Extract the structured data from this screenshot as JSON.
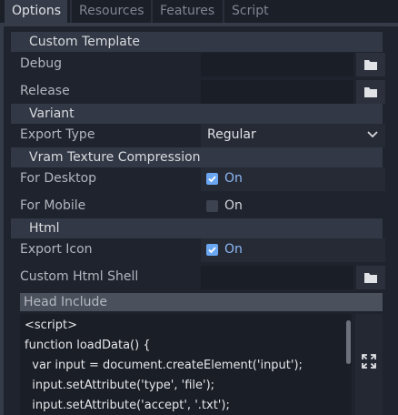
{
  "tabs": [
    {
      "label": "Options",
      "active": true
    },
    {
      "label": "Resources",
      "active": false
    },
    {
      "label": "Features",
      "active": false
    },
    {
      "label": "Script",
      "active": false
    }
  ],
  "sections": {
    "custom_template": "Custom Template",
    "variant": "Variant",
    "vram": "Vram Texture Compression",
    "html": "Html"
  },
  "properties": {
    "debug": {
      "label": "Debug",
      "value": ""
    },
    "release": {
      "label": "Release",
      "value": ""
    },
    "export_type": {
      "label": "Export Type",
      "value": "Regular"
    },
    "for_desktop": {
      "label": "For Desktop",
      "checked": true,
      "text": "On"
    },
    "for_mobile": {
      "label": "For Mobile",
      "checked": false,
      "text": "On"
    },
    "export_icon": {
      "label": "Export Icon",
      "checked": true,
      "text": "On"
    },
    "custom_html_shell": {
      "label": "Custom Html Shell",
      "value": ""
    }
  },
  "head_include": {
    "label": "Head Include",
    "lines": [
      "<script>",
      "function loadData() {",
      "  var input = document.createElement('input');",
      "  input.setAttribute('type', 'file');",
      "  input.setAttribute('accept', '.txt');"
    ]
  },
  "icons": {
    "folder": "folder-icon",
    "chevron": "chevron-down-icon",
    "check": "check-icon",
    "expand": "expand-icon"
  },
  "colors": {
    "accent": "#6ba6f2",
    "background": "#1f232d",
    "panel": "#353b48"
  }
}
